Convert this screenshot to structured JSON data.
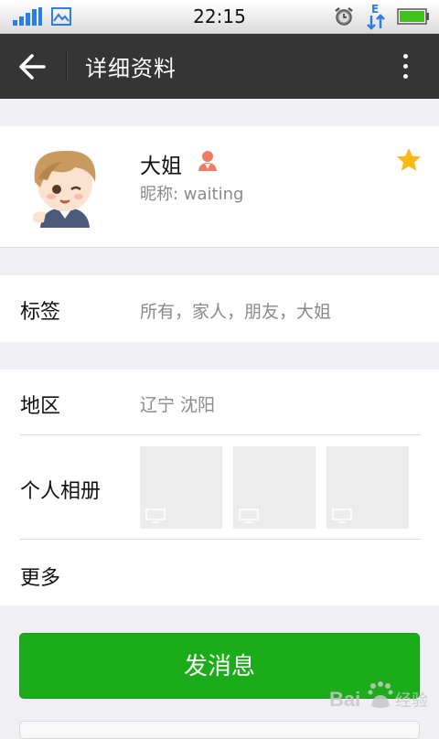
{
  "status_bar": {
    "time": "22:15",
    "data_indicator": "E",
    "icons": [
      "signal-icon",
      "gallery-icon",
      "alarm-icon",
      "data-icon",
      "battery-icon"
    ]
  },
  "header": {
    "title": "详细资料",
    "back_icon": "back-arrow-icon",
    "more_icon": "more-vertical-icon"
  },
  "profile": {
    "name": "大姐",
    "nickname": "昵称: waiting",
    "gender_icon": "female-contact-icon",
    "star_icon": "star-icon",
    "star_color": "#f9b911"
  },
  "tags": {
    "label": "标签",
    "value": "所有，家人，朋友，大姐"
  },
  "details": {
    "region_label": "地区",
    "region_value": "辽宁  沈阳",
    "album_label": "个人相册",
    "more_label": "更多"
  },
  "actions": {
    "send_message": "发消息"
  },
  "watermark": {
    "text_a": "Bai",
    "text_b": "经验"
  },
  "colors": {
    "header_bg": "#353535",
    "accent_green": "#1aad19",
    "page_bg": "#efeff4"
  }
}
